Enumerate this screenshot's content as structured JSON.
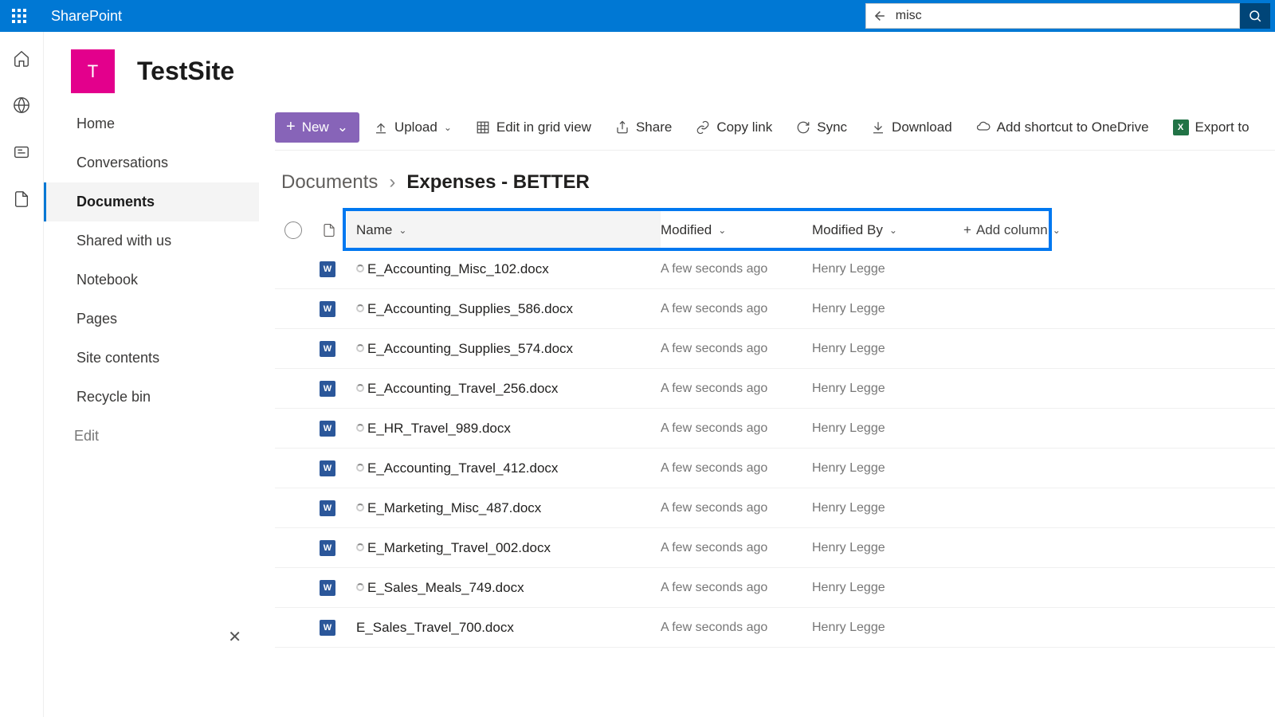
{
  "app": {
    "name": "SharePoint"
  },
  "search": {
    "value": "misc"
  },
  "site": {
    "initial": "T",
    "title": "TestSite"
  },
  "sidenav": {
    "home": "Home",
    "conversations": "Conversations",
    "documents": "Documents",
    "shared": "Shared with us",
    "notebook": "Notebook",
    "pages": "Pages",
    "contents": "Site contents",
    "recycle": "Recycle bin",
    "edit": "Edit"
  },
  "commands": {
    "new": "New",
    "upload": "Upload",
    "grid": "Edit in grid view",
    "share": "Share",
    "copylink": "Copy link",
    "sync": "Sync",
    "download": "Download",
    "shortcut": "Add shortcut to OneDrive",
    "export": "Export to"
  },
  "breadcrumb": {
    "root": "Documents",
    "current": "Expenses - BETTER"
  },
  "columns": {
    "name": "Name",
    "modified": "Modified",
    "modifiedby": "Modified By",
    "add": "Add column"
  },
  "rows": [
    {
      "name": "E_Accounting_Misc_102.docx",
      "modified": "A few seconds ago",
      "by": "Henry Legge"
    },
    {
      "name": "E_Accounting_Supplies_586.docx",
      "modified": "A few seconds ago",
      "by": "Henry Legge"
    },
    {
      "name": "E_Accounting_Supplies_574.docx",
      "modified": "A few seconds ago",
      "by": "Henry Legge"
    },
    {
      "name": "E_Accounting_Travel_256.docx",
      "modified": "A few seconds ago",
      "by": "Henry Legge"
    },
    {
      "name": "E_HR_Travel_989.docx",
      "modified": "A few seconds ago",
      "by": "Henry Legge"
    },
    {
      "name": "E_Accounting_Travel_412.docx",
      "modified": "A few seconds ago",
      "by": "Henry Legge"
    },
    {
      "name": "E_Marketing_Misc_487.docx",
      "modified": "A few seconds ago",
      "by": "Henry Legge"
    },
    {
      "name": "E_Marketing_Travel_002.docx",
      "modified": "A few seconds ago",
      "by": "Henry Legge"
    },
    {
      "name": "E_Sales_Meals_749.docx",
      "modified": "A few seconds ago",
      "by": "Henry Legge"
    },
    {
      "name": "E_Sales_Travel_700.docx",
      "modified": "A few seconds ago",
      "by": "Henry Legge"
    }
  ]
}
